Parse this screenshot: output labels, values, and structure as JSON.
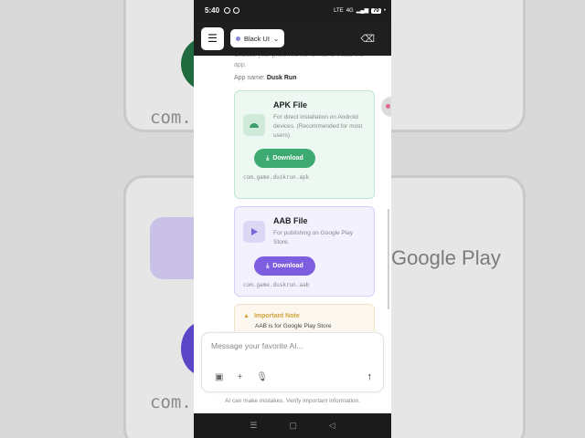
{
  "status_bar": {
    "time": "5:40",
    "network": "4G",
    "signal_bars": "LTE",
    "battery": "70"
  },
  "top_bar": {
    "model_selector_label": "Black UI"
  },
  "content": {
    "intro_text": "Choose your preferred file format to install the app.",
    "app_name_label": "App name:",
    "app_name_value": "Dusk Run",
    "apk": {
      "title": "APK File",
      "description": "For direct installation on Android devices. (Recommended for most users)",
      "download_label": "Download",
      "package": "com.game.duskrun.apk",
      "accent": "#3daa72"
    },
    "aab": {
      "title": "AAB File",
      "description": "For publishing on Google Play Store.",
      "download_label": "Download",
      "package": "com.game.duskrun.aab",
      "accent": "#7d5ee0"
    },
    "note": {
      "title": "Important Note",
      "text": "AAB is for Google Play Store",
      "accent": "#d2a23a"
    }
  },
  "composer": {
    "placeholder": "Message your favorite AI...",
    "disclaimer": "AI can make mistakes. Verify important information."
  },
  "background": {
    "text_1": "com.",
    "text_2": "com.",
    "text_3": "Google Play"
  }
}
